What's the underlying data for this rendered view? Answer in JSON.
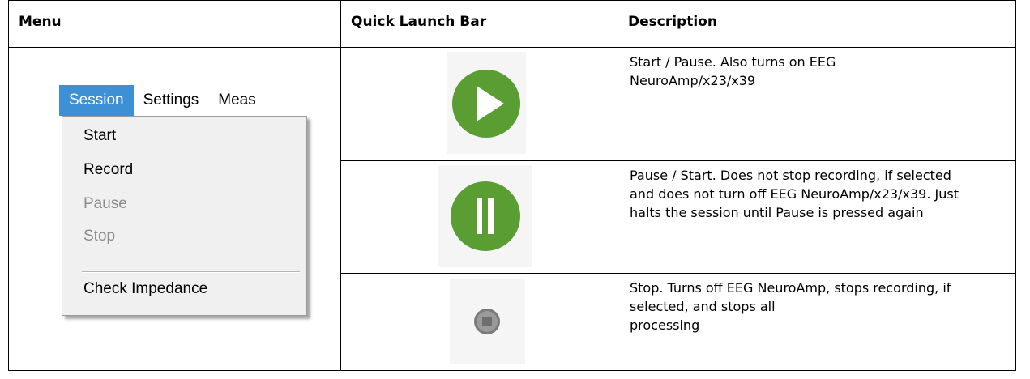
{
  "headers": {
    "menu": "Menu",
    "quick_launch": "Quick Launch Bar",
    "description": "Description"
  },
  "menu": {
    "bar": [
      "Session",
      "Settings",
      "Meas"
    ],
    "items": [
      {
        "label": "Start",
        "enabled": true
      },
      {
        "label": "Record",
        "enabled": true
      },
      {
        "label": "Pause",
        "enabled": false
      },
      {
        "label": "Stop",
        "enabled": false
      },
      {
        "label": "Check Impedance",
        "enabled": true
      }
    ],
    "highlight_color": "#3d8fd6"
  },
  "rows": [
    {
      "icon": "play-icon",
      "icon_color": "#5a9e33",
      "lines": [
        "Start / Pause. Also turns on EEG",
        "NeuroAmp/x23/x39"
      ]
    },
    {
      "icon": "pause-icon",
      "icon_color": "#5a9e33",
      "lines": [
        "Pause / Start. Does not stop recording, if selected",
        "and does not turn off EEG NeuroAmp/x23/x39. Just",
        "halts the session until Pause is pressed again"
      ]
    },
    {
      "icon": "stop-icon",
      "icon_color": "#7a7a7a",
      "lines": [
        "Stop. Turns off EEG NeuroAmp, stops recording, if",
        "selected, and stops all",
        "processing"
      ]
    }
  ]
}
